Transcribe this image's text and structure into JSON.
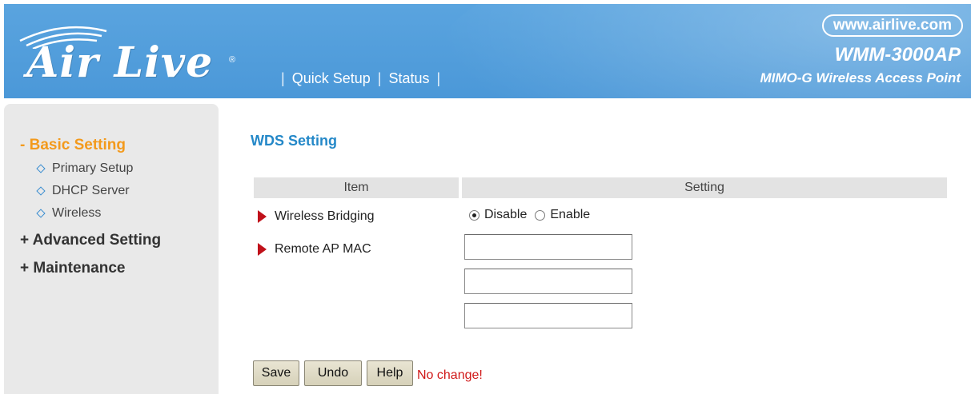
{
  "header": {
    "logo_text": "Air Live",
    "logo_reg": "®",
    "nav": [
      {
        "label": "Quick Setup"
      },
      {
        "label": "Status"
      }
    ],
    "url": "www.airlive.com",
    "model": "WMM-3000AP",
    "subtitle": "MIMO-G Wireless Access Point"
  },
  "sidebar": {
    "groups": [
      {
        "label": "- Basic Setting",
        "active": true
      },
      {
        "label": "+ Advanced Setting",
        "active": false
      },
      {
        "label": "+ Maintenance",
        "active": false
      }
    ],
    "items": [
      {
        "label": "Primary Setup"
      },
      {
        "label": "DHCP Server"
      },
      {
        "label": "Wireless"
      }
    ]
  },
  "main": {
    "title": "WDS Setting",
    "columns": {
      "item": "Item",
      "setting": "Setting"
    },
    "rows": {
      "wireless_bridging": {
        "label": "Wireless Bridging",
        "options": [
          {
            "label": "Disable",
            "selected": true
          },
          {
            "label": "Enable",
            "selected": false
          }
        ]
      },
      "remote_ap_mac": {
        "label": "Remote AP MAC",
        "values": [
          "",
          "",
          ""
        ]
      }
    },
    "buttons": {
      "save": "Save",
      "undo": "Undo",
      "help": "Help"
    },
    "status": "No change!"
  },
  "colors": {
    "header_bg": "#4b98d8",
    "active_menu": "#f39a1c",
    "title": "#2488c8",
    "status": "#d01818",
    "bullet": "#c0111a"
  }
}
